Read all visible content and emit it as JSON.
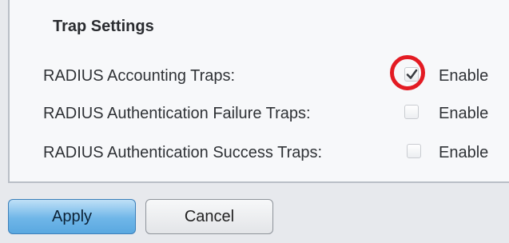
{
  "trap_settings": {
    "title": "Trap Settings",
    "rows": [
      {
        "label": "RADIUS Accounting Traps:",
        "checked": true,
        "option_label": "Enable"
      },
      {
        "label": "RADIUS Authentication Failure Traps:",
        "checked": false,
        "option_label": "Enable"
      },
      {
        "label": "RADIUS Authentication Success Traps:",
        "checked": false,
        "option_label": "Enable"
      }
    ]
  },
  "buttons": {
    "apply_label": "Apply",
    "cancel_label": "Cancel"
  },
  "colors": {
    "highlight": "#e31b23",
    "apply_button": "#6fb6e8"
  },
  "icons": {
    "checkmark": "checkmark-icon"
  }
}
